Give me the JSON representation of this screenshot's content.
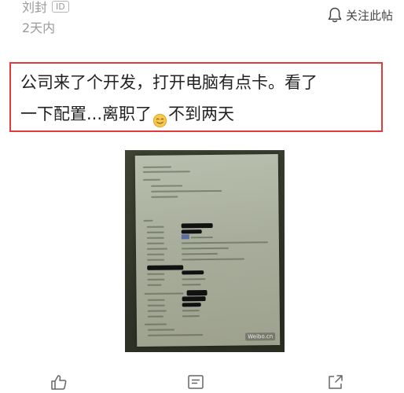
{
  "post": {
    "author": "刘封",
    "id_badge": "ID",
    "time": "2天内",
    "follow_label": "关注此帖",
    "text_line1": "公司来了个开发，打开电脑有点卡。看了",
    "text_line2_a": "一下配置...离职了",
    "text_line2_b": "不到两天"
  },
  "image": {
    "watermark": "Weibo.cn"
  }
}
